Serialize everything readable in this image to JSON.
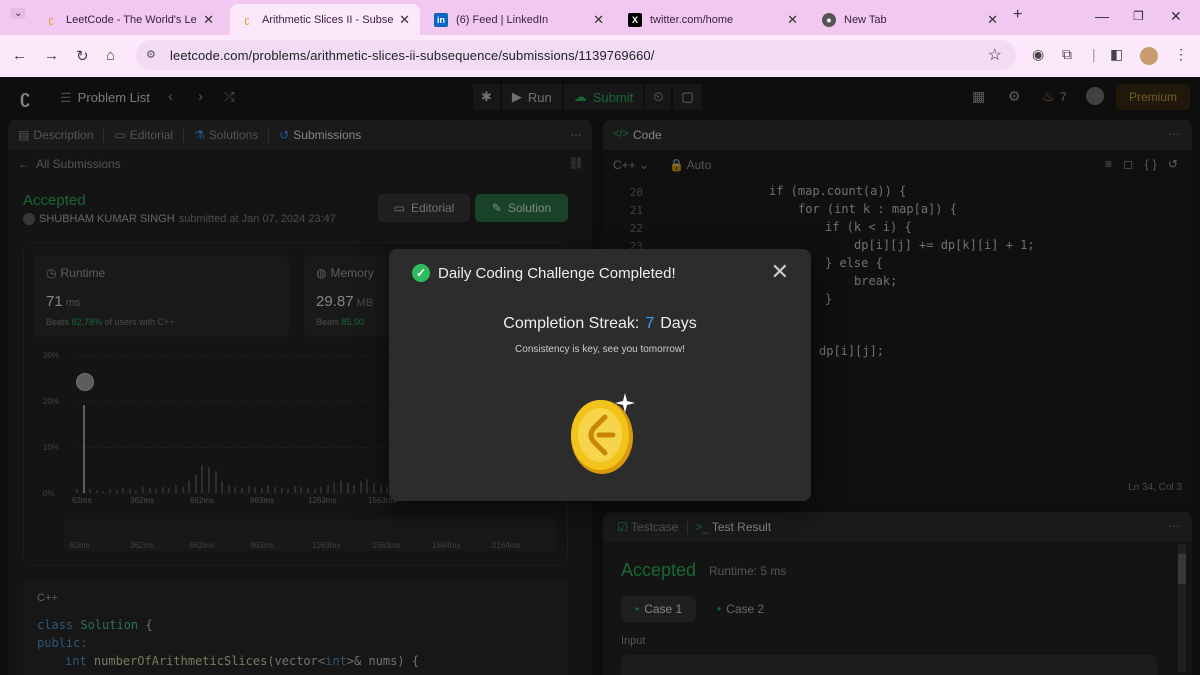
{
  "browser": {
    "tabs": [
      {
        "title": "LeetCode - The World's Lead",
        "icon": "leetcode-icon"
      },
      {
        "title": "Arithmetic Slices II - Subseque",
        "icon": "leetcode-icon"
      },
      {
        "title": "(6) Feed | LinkedIn",
        "icon": "linkedin-icon"
      },
      {
        "title": "twitter.com/home",
        "icon": "x-icon"
      },
      {
        "title": "New Tab",
        "icon": "chrome-icon"
      }
    ],
    "url": "leetcode.com/problems/arithmetic-slices-ii-subsequence/submissions/1139769660/"
  },
  "lc_nav": {
    "problem_list": "Problem List",
    "run": "Run",
    "submit": "Submit",
    "streak_count": "7",
    "premium": "Premium"
  },
  "left_panel": {
    "tabs": [
      "Description",
      "Editorial",
      "Solutions",
      "Submissions"
    ],
    "all_submissions": "All Submissions",
    "status": "Accepted",
    "author": "SHUBHAM KUMAR SINGH",
    "submitted_at": "submitted at Jan 07, 2024 23:47",
    "editorial_btn": "Editorial",
    "solution_btn": "Solution",
    "runtime": {
      "label": "Runtime",
      "value": "71",
      "unit": "ms",
      "beats_prefix": "Beats",
      "beats_pct": "82.78%",
      "beats_suffix": "of users with C++"
    },
    "memory": {
      "label": "Memory",
      "value": "29.87",
      "unit": "MB",
      "beats_prefix": "Beats",
      "beats_pct": "85.00"
    },
    "y_labels": [
      "30%",
      "20%",
      "10%",
      "0%"
    ],
    "x_labels": [
      "62ms",
      "362ms",
      "662ms",
      "963ms",
      "1263ms",
      "1563ms"
    ],
    "minimap_labels": [
      "62ms",
      "362ms",
      "662ms",
      "963ms",
      "1263ms",
      "1563ms",
      "1864ms",
      "2164ms"
    ],
    "code_lang": "C++",
    "code": {
      "l1_kw": "class",
      "l1_name": "Solution",
      "l1_brace": "{",
      "l2": "public:",
      "l3_type": "int",
      "l3_fn": "numberOfArithmeticSlices",
      "l3_a": "(vector<",
      "l3_int": "int",
      "l3_b": ">& nums) {"
    }
  },
  "right_panel": {
    "title": "Code",
    "lang": "C++",
    "auto": "Auto",
    "line_numbers": [
      "20",
      "21",
      "22",
      "23"
    ],
    "lines": [
      "if (map.count(a)) {",
      "for (int k : map[a]) {",
      "if (k < i) {",
      "dp[i][j] += dp[k][i] + 1;",
      "} else {",
      "break;",
      "}",
      "dp[i][j];"
    ],
    "cursor": "Ln 34, Col 3"
  },
  "test_panel": {
    "tab1": "Testcase",
    "tab2": "Test Result",
    "status": "Accepted",
    "runtime": "Runtime: 5 ms",
    "case1": "Case 1",
    "case2": "Case 2",
    "input_label": "Input"
  },
  "modal": {
    "title": "Daily Coding Challenge Completed!",
    "streak_label": "Completion Streak:",
    "streak_num": "7",
    "streak_unit": "Days",
    "subtitle": "Consistency is key, see you tomorrow!"
  },
  "colors": {
    "accent_green": "#2cbb5d",
    "streak_blue": "#3d9aff",
    "coin_gold": "#f2c31b"
  }
}
